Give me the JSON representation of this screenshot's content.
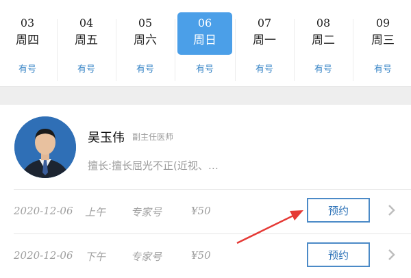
{
  "dates": [
    {
      "day": "03",
      "weekday": "周四",
      "status": "有号",
      "selected": false
    },
    {
      "day": "04",
      "weekday": "周五",
      "status": "有号",
      "selected": false
    },
    {
      "day": "05",
      "weekday": "周六",
      "status": "有号",
      "selected": false
    },
    {
      "day": "06",
      "weekday": "周日",
      "status": "有号",
      "selected": true
    },
    {
      "day": "07",
      "weekday": "周一",
      "status": "有号",
      "selected": false
    },
    {
      "day": "08",
      "weekday": "周二",
      "status": "有号",
      "selected": false
    },
    {
      "day": "09",
      "weekday": "周三",
      "status": "有号",
      "selected": false
    }
  ],
  "doctor": {
    "name": "吴玉伟",
    "title": "副主任医师",
    "specialty": "擅长:擅长屈光不正(近视、…"
  },
  "slots": [
    {
      "date": "2020-12-06",
      "period": "上午",
      "type": "专家号",
      "price": "¥50",
      "button": "预约"
    },
    {
      "date": "2020-12-06",
      "period": "下午",
      "type": "专家号",
      "price": "¥50",
      "button": "预约"
    }
  ],
  "colors": {
    "accent": "#4b9fe8",
    "status_text": "#3a86c7",
    "annotation_arrow": "#e53935"
  },
  "icons": {
    "row_action": "chevron-right-icon",
    "annotation": "arrow-annotation"
  }
}
